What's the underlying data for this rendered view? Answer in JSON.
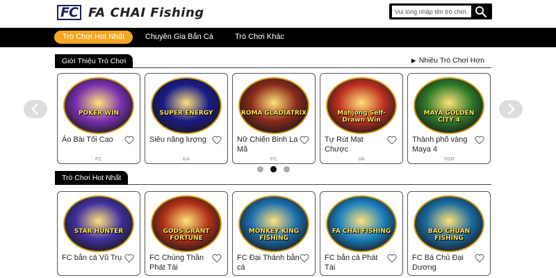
{
  "header": {
    "logo_mark": "FC",
    "logo_text": "FA CHAI Fishing",
    "search_placeholder": "Vui lòng nhập tên trò chơi."
  },
  "nav": {
    "items": [
      {
        "label": "Trò Chơi Hot Nhất",
        "active": true
      },
      {
        "label": "Chuyên Gia Bắn Cá",
        "active": false
      },
      {
        "label": "Trò Chơi Khác",
        "active": false
      }
    ]
  },
  "section_intro": {
    "title": "Giới Thiệu Trò Chơi",
    "more_label": "Nhiều Trò Chơi Hơn",
    "cards": [
      {
        "name": "Áo Bài Tối Cao",
        "provider": "FC",
        "art": "POKER WIN",
        "color": "#7a2fb0"
      },
      {
        "name": "Siêu năng lượng",
        "provider": "KA",
        "art": "SUPER ENERGY",
        "color": "#1a1a8a"
      },
      {
        "name": "Nữ Chiến Binh La Mã",
        "provider": "FC",
        "art": "ROMA GLADIATRIX",
        "color": "#8a2a1a"
      },
      {
        "name": "Tự Rút Mạt Chược",
        "provider": "VA",
        "art": "Mahjong Self-Drawn Win",
        "color": "#c03020"
      },
      {
        "name": "Thành phố vàng Maya 4",
        "provider": "YGR",
        "art": "MAYA GOLDEN CITY 4",
        "color": "#2f7a2a"
      }
    ],
    "dots": [
      false,
      true,
      false
    ]
  },
  "section_hot": {
    "title": "Trò Chơi Hot Nhất",
    "cards": [
      {
        "name": "FC bắn cá Vũ Trụ",
        "art": "STAR HUNTER",
        "color": "#4030a0"
      },
      {
        "name": "FC Chúng Thần Phát Tài",
        "art": "GODS GRANT FORTUNE",
        "color": "#b03018"
      },
      {
        "name": "FC Đại Thánh bắn cá",
        "art": "MONKEY KING FISHING",
        "color": "#1c6fb0"
      },
      {
        "name": "FC bắn cá Phát Tài",
        "art": "FA CHAI FISHING",
        "color": "#1a80c0"
      },
      {
        "name": "FC Bá Chủ Đại Dương",
        "art": "BAO CHUAN FISHING",
        "color": "#1a6aa0"
      }
    ]
  }
}
